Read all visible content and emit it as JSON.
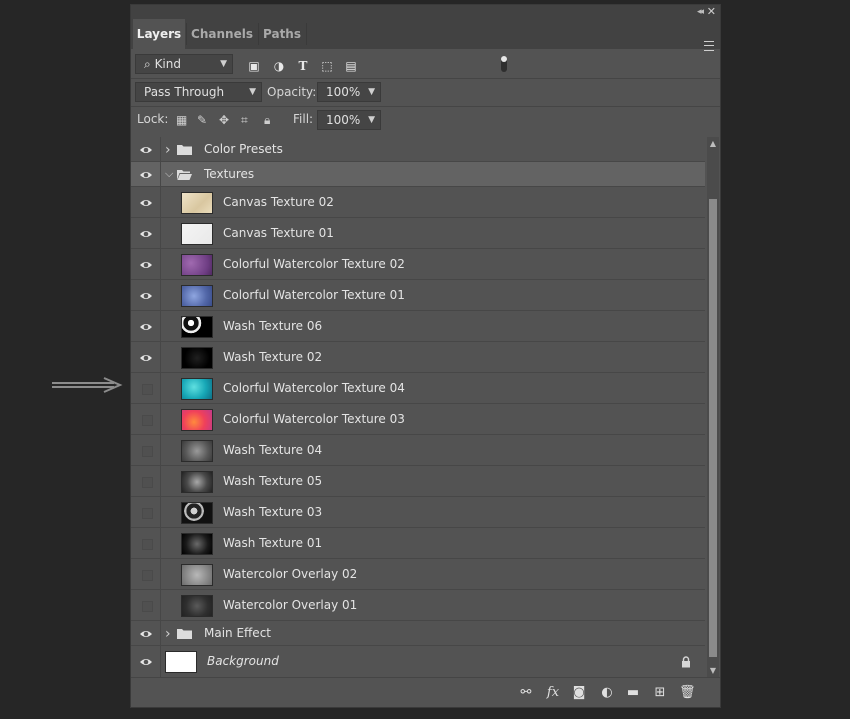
{
  "tabs": [
    {
      "label": "Layers",
      "active": true
    },
    {
      "label": "Channels",
      "active": false
    },
    {
      "label": "Paths",
      "active": false
    }
  ],
  "filter": {
    "kind_label": "Kind",
    "filter_icons": [
      "image-icon",
      "adjustment-icon",
      "type-icon",
      "shape-icon",
      "smart-object-icon"
    ]
  },
  "blend": {
    "mode": "Pass Through",
    "opacity_label": "Opacity:",
    "opacity_value": "100%"
  },
  "lock": {
    "label": "Lock:",
    "fill_label": "Fill:",
    "fill_value": "100%"
  },
  "layers": [
    {
      "name": "Color Presets",
      "type": "group",
      "visible": true,
      "expanded": false,
      "indent": 0
    },
    {
      "name": "Textures",
      "type": "group",
      "visible": true,
      "expanded": true,
      "indent": 0,
      "selected": true
    },
    {
      "name": "Canvas Texture 02",
      "type": "layer",
      "visible": true,
      "thumb": "canvas02"
    },
    {
      "name": "Canvas Texture 01",
      "type": "layer",
      "visible": true,
      "thumb": "canvas01"
    },
    {
      "name": "Colorful Watercolor Texture 02",
      "type": "layer",
      "visible": true,
      "thumb": "purple"
    },
    {
      "name": "Colorful Watercolor Texture 01",
      "type": "layer",
      "visible": true,
      "thumb": "blue"
    },
    {
      "name": "Wash Texture 06",
      "type": "layer",
      "visible": true,
      "thumb": "wash06"
    },
    {
      "name": "Wash Texture 02",
      "type": "layer",
      "visible": true,
      "thumb": "wash02"
    },
    {
      "name": "Colorful Watercolor Texture 04",
      "type": "layer",
      "visible": false,
      "thumb": "teal"
    },
    {
      "name": "Colorful Watercolor Texture 03",
      "type": "layer",
      "visible": false,
      "thumb": "orange"
    },
    {
      "name": "Wash Texture 04",
      "type": "layer",
      "visible": false,
      "thumb": "wash04"
    },
    {
      "name": "Wash Texture 05",
      "type": "layer",
      "visible": false,
      "thumb": "wash05"
    },
    {
      "name": "Wash Texture 03",
      "type": "layer",
      "visible": false,
      "thumb": "wash03"
    },
    {
      "name": "Wash Texture 01",
      "type": "layer",
      "visible": false,
      "thumb": "wash01"
    },
    {
      "name": "Watercolor Overlay 02",
      "type": "layer",
      "visible": false,
      "thumb": "overlay02"
    },
    {
      "name": "Watercolor Overlay 01",
      "type": "layer",
      "visible": false,
      "thumb": "overlay01"
    },
    {
      "name": "Main Effect",
      "type": "group",
      "visible": true,
      "expanded": false,
      "indent": 0
    },
    {
      "name": "Background",
      "type": "background",
      "visible": true,
      "locked": true
    }
  ],
  "thumb_styles": {
    "canvas02": "linear-gradient(135deg,#efe3c8,#d9c7a0 60%,#eadcbc)",
    "canvas01": "linear-gradient(135deg,#f4f4f4,#e9e9e9)",
    "purple": "radial-gradient(circle at 30% 40%,#a06ab0,#6e3d83 70%,#4f2a60)",
    "blue": "radial-gradient(circle at 40% 50%,#8fa6e0,#5368a9 60%,#3a4d8a)",
    "wash06": "radial-gradient(circle at 30% 30%,#ffffff 0 12%,#111 13% 30%,#eee 31% 40%,#000 41%)",
    "wash02": "radial-gradient(circle at 50% 50%,#202020,#000 70%)",
    "teal": "radial-gradient(circle at 40% 40%,#5fe0e0,#17a7b6 55%,#0e6f86)",
    "orange": "radial-gradient(circle at 40% 60%,#ff8a3d,#f0405a 50%,#c13a8a)",
    "wash04": "radial-gradient(circle at 50% 50%,#9a9a9a,#5a5a5a 60%,#3a3a3a)",
    "wash05": "radial-gradient(circle at 50% 50%,#a8a8a8,#4a4a4a 55%,#222)",
    "wash03": "radial-gradient(circle at 40% 40%,#cfcfcf 0 15%,#222 16% 35%,#bbb 36% 45%,#111 46%)",
    "wash01": "radial-gradient(circle at 50% 50%,#6a6a6a,#1a1a1a 60%,#000)",
    "overlay02": "radial-gradient(circle at 50% 50%,#b8b8b8,#8a8a8a 60%,#6d6d6d)",
    "overlay01": "radial-gradient(circle at 50% 50%,#5a5a5a,#2f2f2f 60%,#222)"
  },
  "bottom_icons": [
    "link-icon",
    "fx-icon",
    "mask-icon",
    "adjustment-layer-icon",
    "new-group-icon",
    "new-layer-icon",
    "trash-icon"
  ]
}
